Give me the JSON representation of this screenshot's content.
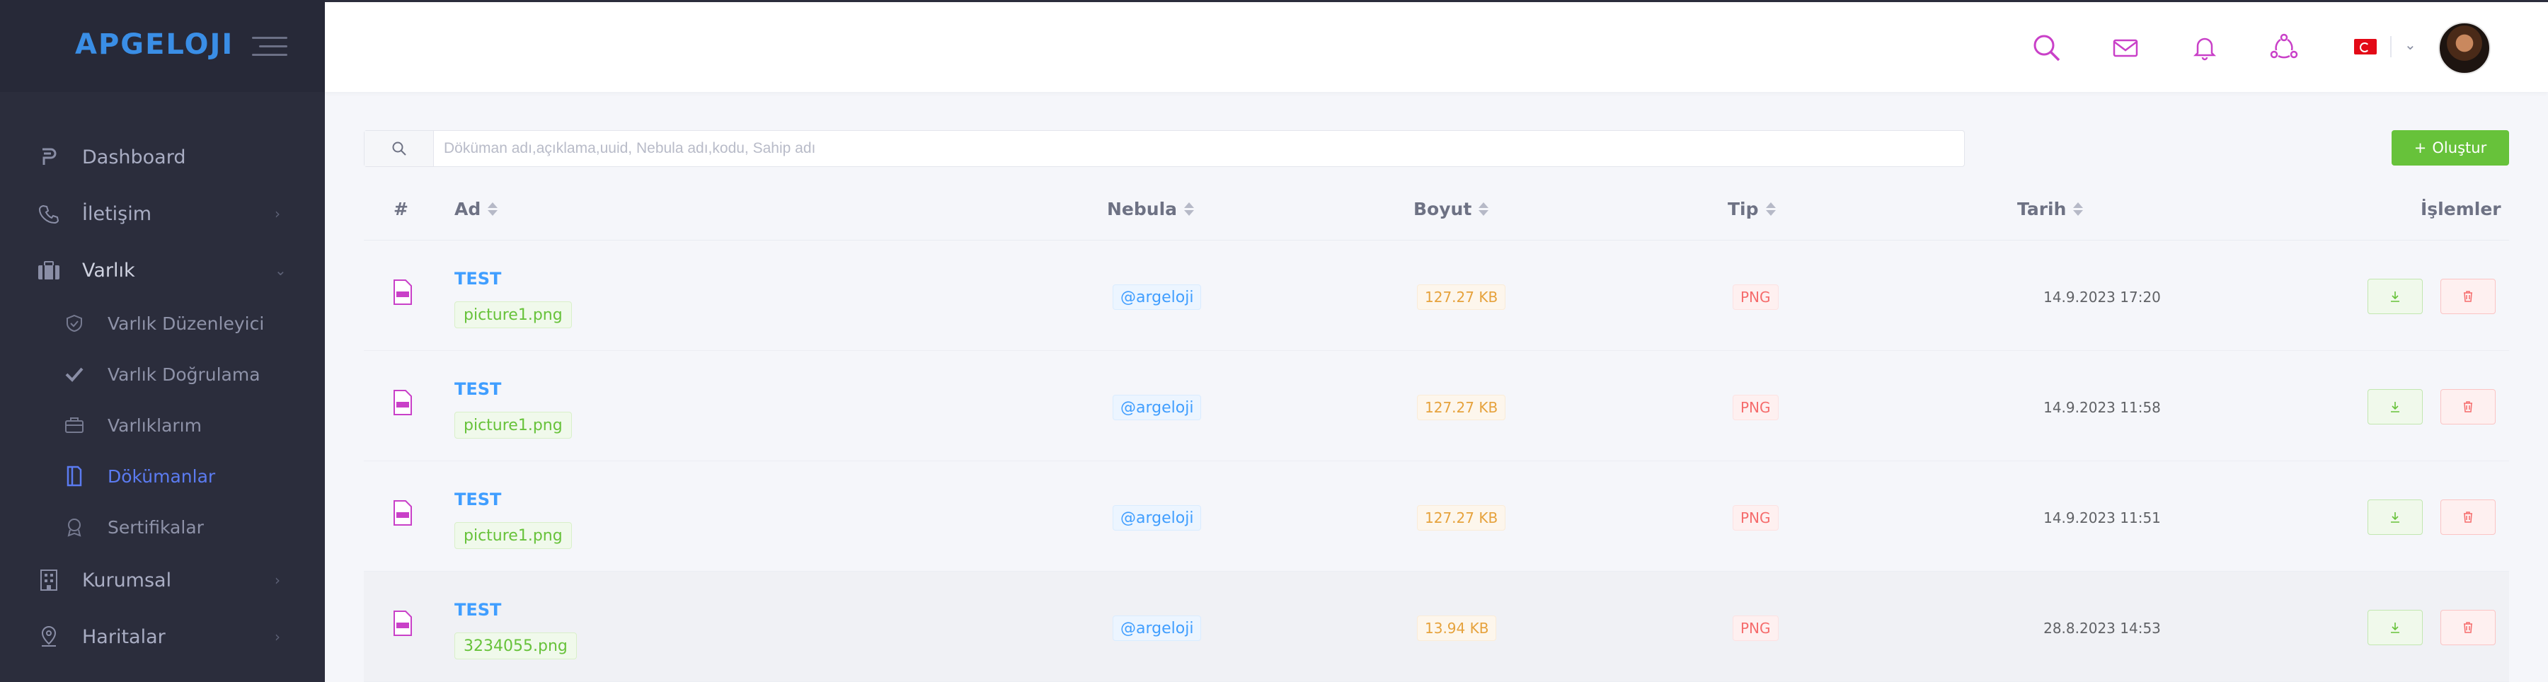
{
  "brand": {
    "logo_text": "APGELOJI"
  },
  "colors": {
    "sidebar_bg": "#2b2d3c",
    "accent_blue": "#409eff",
    "create_green": "#67c23a",
    "active_menu": "#5b7bf1",
    "topbar_icon_pink": "#c940c8"
  },
  "sidebar": {
    "items": [
      {
        "label": "Dashboard",
        "icon": "dashboard-icon"
      },
      {
        "label": "İletişim",
        "icon": "phone-icon",
        "has_children": true
      },
      {
        "label": "Varlık",
        "icon": "briefcase-icon",
        "expanded": true
      },
      {
        "label": "Kurumsal",
        "icon": "building-icon",
        "has_children": true
      },
      {
        "label": "Haritalar",
        "icon": "map-pin-icon",
        "has_children": true
      }
    ],
    "sub_items": [
      {
        "label": "Varlık Düzenleyici",
        "icon": "shield-icon"
      },
      {
        "label": "Varlık Doğrulama",
        "icon": "check-icon"
      },
      {
        "label": "Varlıklarım",
        "icon": "briefcase-outline-icon"
      },
      {
        "label": "Dökümanlar",
        "icon": "document-icon",
        "active": true
      },
      {
        "label": "Sertifikalar",
        "icon": "award-icon"
      }
    ]
  },
  "topbar": {
    "icons": [
      "search-icon",
      "mail-icon",
      "bell-icon",
      "share-icon"
    ],
    "language_flag": "turkey-flag-icon"
  },
  "search": {
    "placeholder": "Döküman adı,açıklama,uuid, Nebula adı,kodu, Sahip adı"
  },
  "create_button": {
    "label": "Oluştur"
  },
  "table": {
    "headers": {
      "index": "#",
      "name": "Ad",
      "nebula": "Nebula",
      "size": "Boyut",
      "type": "Tip",
      "date": "Tarih",
      "actions": "İşlemler"
    },
    "rows": [
      {
        "name": "TEST",
        "file": "picture1.png",
        "nebula": "@argeloji",
        "size": "127.27 KB",
        "type": "PNG",
        "date": "14.9.2023 17:20"
      },
      {
        "name": "TEST",
        "file": "picture1.png",
        "nebula": "@argeloji",
        "size": "127.27 KB",
        "type": "PNG",
        "date": "14.9.2023 11:58"
      },
      {
        "name": "TEST",
        "file": "picture1.png",
        "nebula": "@argeloji",
        "size": "127.27 KB",
        "type": "PNG",
        "date": "14.9.2023 11:51"
      },
      {
        "name": "TEST",
        "file": "3234055.png",
        "nebula": "@argeloji",
        "size": "13.94 KB",
        "type": "PNG",
        "date": "28.8.2023 14:53"
      }
    ]
  }
}
